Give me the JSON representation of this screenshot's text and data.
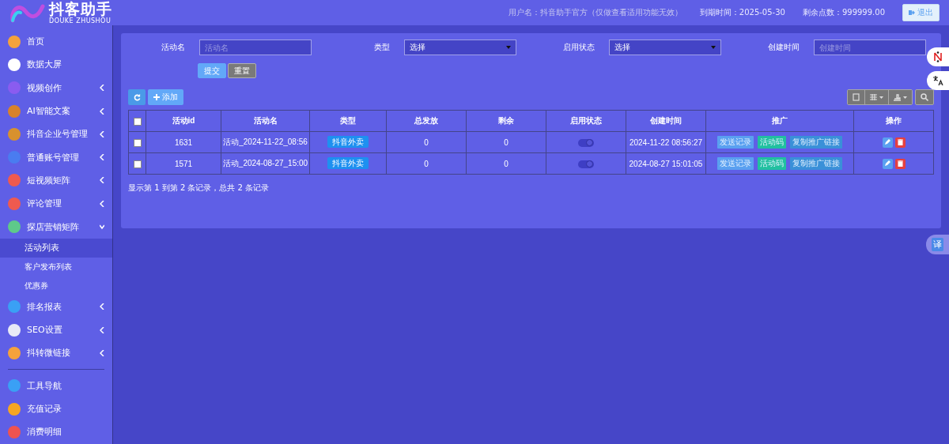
{
  "header": {
    "logo_title": "抖客助手",
    "logo_subtitle": "DOUKE ZHUSHOU",
    "user": "用户名：抖音助手官方（仅做查看适用功能无效）",
    "expiry": "到期时间：2025-05-30",
    "points": "剩余点数：999999.00",
    "logout": "退出"
  },
  "sidebar": {
    "items": [
      {
        "label": "首页",
        "color": "#f5a23c",
        "has_submenu": false
      },
      {
        "label": "数据大屏",
        "color": "#ffffff",
        "has_submenu": false
      },
      {
        "label": "视频创作",
        "color": "#8a5cf0",
        "has_submenu": true
      },
      {
        "label": "AI智能文案",
        "color": "#d9822b",
        "has_submenu": true
      },
      {
        "label": "抖音企业号管理",
        "color": "#d8912e",
        "has_submenu": true
      },
      {
        "label": "普通账号管理",
        "color": "#4a7cf0",
        "has_submenu": true
      },
      {
        "label": "短视频矩阵",
        "color": "#ef5a4f",
        "has_submenu": true
      },
      {
        "label": "评论管理",
        "color": "#ef5a4f",
        "has_submenu": true
      },
      {
        "label": "探店营销矩阵",
        "color": "#5ec98a",
        "has_submenu": true,
        "expanded": true,
        "children": [
          {
            "label": "活动列表",
            "selected": true
          },
          {
            "label": "客户发布列表",
            "selected": false
          },
          {
            "label": "优惠券",
            "selected": false
          }
        ]
      },
      {
        "label": "排名报表",
        "color": "#3aa0f5",
        "has_submenu": true
      },
      {
        "label": "SEO设置",
        "color": "#e8eaf6",
        "has_submenu": true
      },
      {
        "label": "抖转微链接",
        "color": "#f5a23c",
        "has_submenu": true
      }
    ],
    "bottom_items": [
      {
        "label": "工具导航",
        "color": "#3aa0f5"
      },
      {
        "label": "充值记录",
        "color": "#f5a623"
      },
      {
        "label": "消费明细",
        "color": "#ef5350"
      }
    ]
  },
  "filters": [
    {
      "label": "活动名",
      "kind": "text",
      "placeholder": "活动名"
    },
    {
      "label": "类型",
      "kind": "select",
      "value": "选择"
    },
    {
      "label": "启用状态",
      "kind": "select",
      "value": "选择"
    },
    {
      "label": "创建时间",
      "kind": "text",
      "placeholder": "创建时间"
    }
  ],
  "filter_buttons": [
    "提交",
    "重置"
  ],
  "toolbar": {
    "add": "添加"
  },
  "table": {
    "select_all": false,
    "columns": [
      "活动id",
      "活动名",
      "类型",
      "总发放",
      "剩余",
      "启用状态",
      "创建时间",
      "推广",
      "操作"
    ],
    "rows": [
      {
        "checked": false,
        "id": "1631",
        "name": "活动_2024-11-22_08:56",
        "type": "抖音外卖",
        "total": "0",
        "remaining": "0",
        "enabled": true,
        "created": "2024-11-22 08:56:27",
        "promo": [
          "发送记录",
          "活动码",
          "复制推广链接"
        ]
      },
      {
        "checked": false,
        "id": "1571",
        "name": "活动_2024-08-27_15:00",
        "type": "抖音外卖",
        "total": "0",
        "remaining": "0",
        "enabled": true,
        "created": "2024-08-27 15:01:05",
        "promo": [
          "发送记录",
          "活动码",
          "复制推广链接"
        ]
      }
    ]
  },
  "pagination_info": "显示第 1 到第 2 条记录，总共 2 条记录",
  "translate_button": "译"
}
